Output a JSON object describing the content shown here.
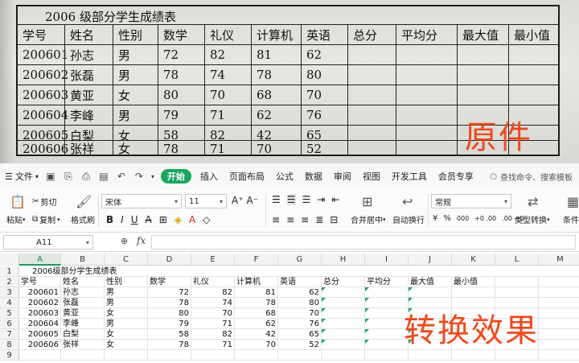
{
  "photo": {
    "title": "2006 级部分学生成绩表",
    "headers": [
      "学号",
      "姓名",
      "性别",
      "数学",
      "礼仪",
      "计算机",
      "英语",
      "总分",
      "平均分",
      "最大值",
      "最小值"
    ],
    "rows": [
      [
        "200601",
        "孙志",
        "男",
        "72",
        "82",
        "81",
        "62",
        "",
        "",
        "",
        ""
      ],
      [
        "200602",
        "张磊",
        "男",
        "78",
        "74",
        "78",
        "80",
        "",
        "",
        "",
        ""
      ],
      [
        "200603",
        "黄亚",
        "女",
        "80",
        "70",
        "68",
        "70",
        "",
        "",
        "",
        ""
      ],
      [
        "200604",
        "李峰",
        "男",
        "79",
        "71",
        "62",
        "76",
        "",
        "",
        "",
        ""
      ],
      [
        "200605",
        "白梨",
        "女",
        "58",
        "82",
        "42",
        "65",
        "",
        "",
        "",
        ""
      ],
      [
        "200606",
        "张祥",
        "女",
        "78",
        "71",
        "70",
        "52",
        "",
        "",
        "",
        ""
      ]
    ],
    "stamp": "原件"
  },
  "app": {
    "menubar": {
      "file_label": "文件",
      "tabs": [
        "开始",
        "插入",
        "页面布局",
        "公式",
        "数据",
        "审阅",
        "视图",
        "开发工具",
        "会员专享"
      ],
      "active_tab": "开始",
      "search_placeholder": "查找命令、搜索模板"
    },
    "ribbon": {
      "paste": "粘贴",
      "cut": "剪切",
      "copy": "复制",
      "format_painter": "格式刷",
      "font_name": "宋体",
      "font_size": "11",
      "bold": "B",
      "italic": "I",
      "underline": "U",
      "merge_center": "合并居中",
      "wrap_text": "自动换行",
      "number_format": "常规",
      "currency": "¥",
      "percent": "%",
      "thousands": "000",
      "inc_decimal": "+0 .00",
      "dec_decimal": ".00 →0",
      "type_convert": "类型转换",
      "conditional": "条件格"
    },
    "formula_bar": {
      "cell_ref": "A11",
      "formula": ""
    },
    "columns": [
      "A",
      "B",
      "C",
      "D",
      "E",
      "F",
      "G",
      "H",
      "I",
      "J",
      "K",
      "L",
      "M"
    ],
    "selected_column": "A",
    "row_numbers": [
      "1",
      "2",
      "3",
      "4",
      "5",
      "6",
      "7",
      "8",
      "9"
    ],
    "sheet": {
      "title": "2006级部分学生成绩表",
      "headers": [
        "学号",
        "姓名",
        "性别",
        "数学",
        "礼仪",
        "计算机",
        "英语",
        "总分",
        "平均分",
        "最大值",
        "最小值"
      ],
      "rows": [
        [
          "200601",
          "孙志",
          "男",
          "72",
          "82",
          "81",
          "62"
        ],
        [
          "200602",
          "张磊",
          "男",
          "78",
          "74",
          "78",
          "80"
        ],
        [
          "200603",
          "黄亚",
          "女",
          "80",
          "70",
          "68",
          "70"
        ],
        [
          "200604",
          "李峰",
          "男",
          "79",
          "71",
          "62",
          "76"
        ],
        [
          "200605",
          "白梨",
          "女",
          "58",
          "82",
          "42",
          "65"
        ],
        [
          "200606",
          "张祥",
          "女",
          "78",
          "71",
          "70",
          "52"
        ]
      ]
    },
    "stamp": "转换效果",
    "colors": {
      "accent": "#19a55f",
      "stamp": "#ee4a1e"
    }
  }
}
